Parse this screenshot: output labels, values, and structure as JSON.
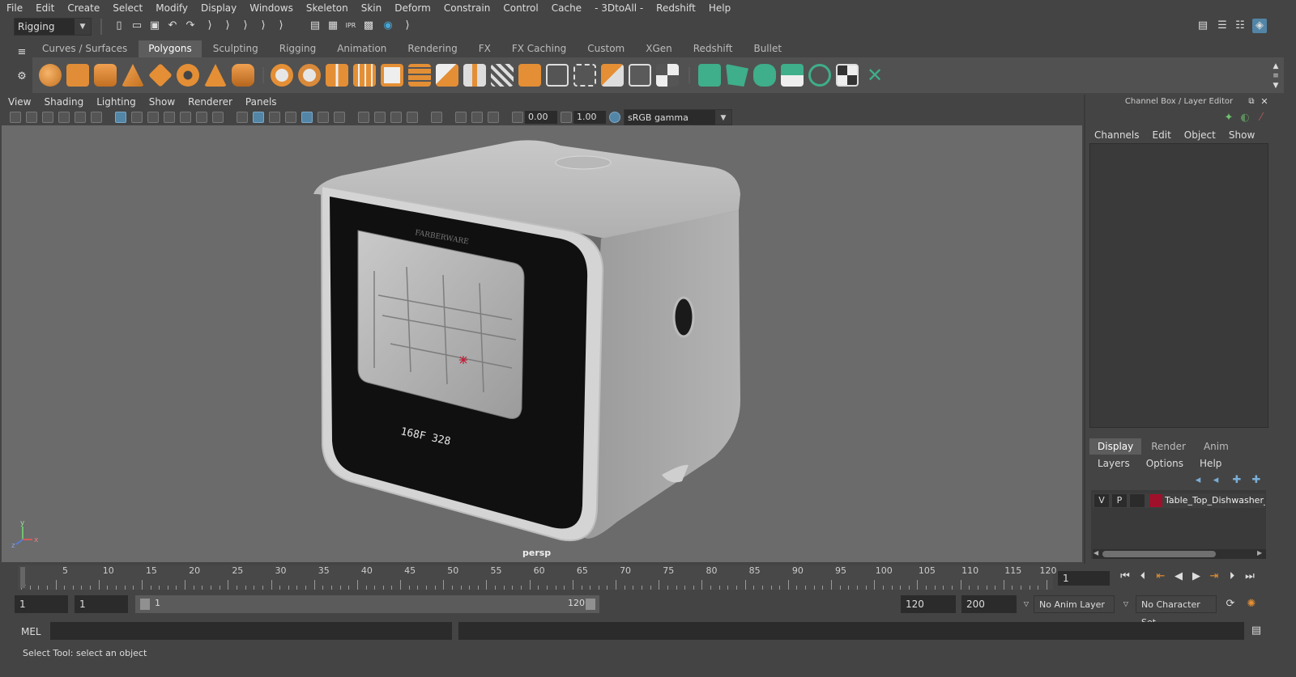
{
  "menubar": [
    "File",
    "Edit",
    "Create",
    "Select",
    "Modify",
    "Display",
    "Windows",
    "Skeleton",
    "Skin",
    "Deform",
    "Constrain",
    "Control",
    "Cache",
    "- 3DtoAll -",
    "Redshift",
    "Help"
  ],
  "statusline": {
    "mode": "Rigging"
  },
  "shelf_tabs": [
    "Curves / Surfaces",
    "Polygons",
    "Sculpting",
    "Rigging",
    "Animation",
    "Rendering",
    "FX",
    "FX Caching",
    "Custom",
    "XGen",
    "Redshift",
    "Bullet"
  ],
  "shelf_active": "Polygons",
  "viewport_menu": [
    "View",
    "Shading",
    "Lighting",
    "Show",
    "Renderer",
    "Panels"
  ],
  "viewport_tools": {
    "exposure": "0.00",
    "gamma": "1.00",
    "color_space": "sRGB gamma"
  },
  "viewport": {
    "camera": "persp",
    "axis_y": "y",
    "axis_x": "x",
    "axis_z": "z"
  },
  "model": {
    "brand": "FARBERWARE",
    "display": "168F 328"
  },
  "channel_box": {
    "title": "Channel Box / Layer Editor",
    "menu": [
      "Channels",
      "Edit",
      "Object",
      "Show"
    ]
  },
  "layer_editor": {
    "tabs": [
      "Display",
      "Render",
      "Anim"
    ],
    "active_tab": "Display",
    "menu": [
      "Layers",
      "Options",
      "Help"
    ],
    "layer": {
      "v": "V",
      "p": "P",
      "name": "Table_Top_Dishwasher_F",
      "color": "#a0102a"
    }
  },
  "timeline": {
    "labels": [
      "1",
      "5",
      "10",
      "15",
      "20",
      "25",
      "30",
      "35",
      "40",
      "45",
      "50",
      "55",
      "60",
      "65",
      "70",
      "75",
      "80",
      "85",
      "90",
      "95",
      "100",
      "105",
      "110",
      "115",
      "120"
    ],
    "current_frame": "1"
  },
  "range": {
    "start": "1",
    "playback_start": "1",
    "slider_start": "1",
    "slider_end": "120",
    "playback_end": "120",
    "end": "200",
    "anim_layer": "No Anim Layer",
    "character_set": "No Character Set"
  },
  "mel": {
    "label": "MEL"
  },
  "help_line": "Select Tool: select an object"
}
